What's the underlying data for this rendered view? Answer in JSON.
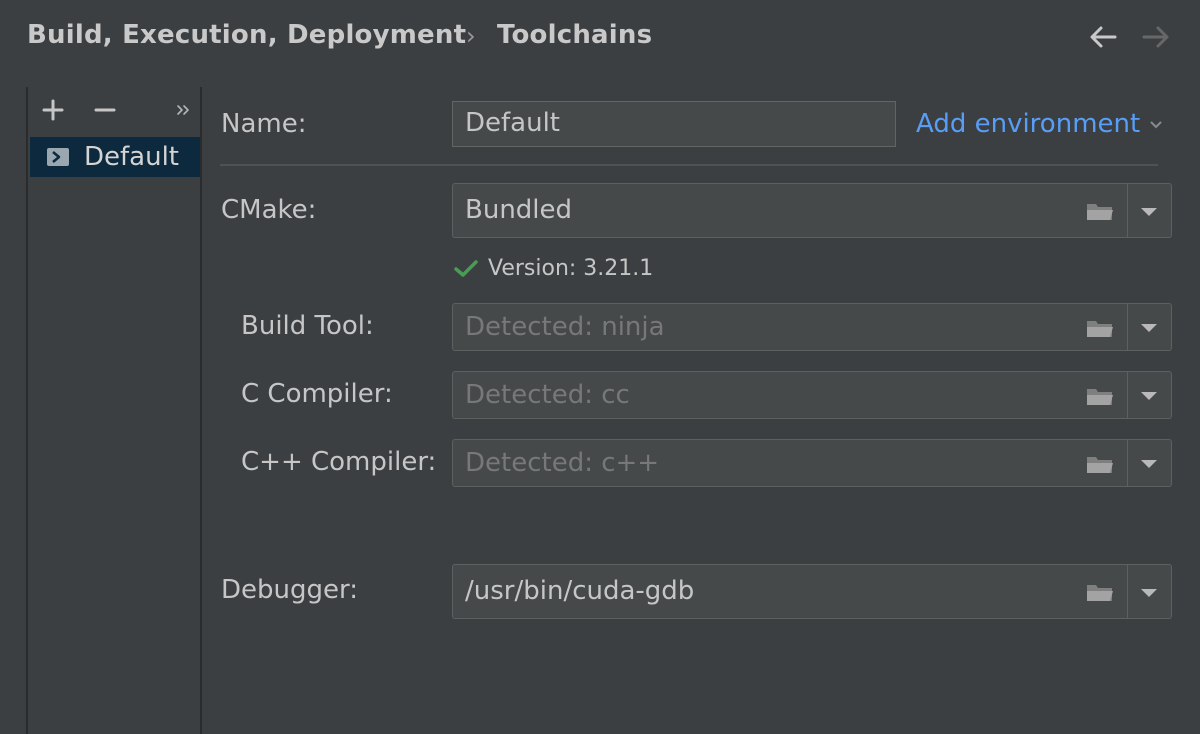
{
  "breadcrumb": {
    "parent": "Build, Execution, Deployment",
    "separator": "›",
    "current": "Toolchains"
  },
  "nav": {
    "back_icon": "arrow-left-icon",
    "forward_icon": "arrow-right-icon",
    "forward_enabled": false
  },
  "toolbar": {
    "add_icon": "plus-icon",
    "remove_icon": "minus-icon",
    "more_icon": "double-chevron-right-icon"
  },
  "toolchains": [
    {
      "name": "Default",
      "icon": "terminal-icon",
      "selected": true
    }
  ],
  "form": {
    "name_label": "Name:",
    "name_value": "Default",
    "add_environment": "Add environment",
    "cmake_label": "CMake:",
    "cmake_value": "Bundled",
    "cmake_version": "Version: 3.21.1",
    "build_tool_label": "Build Tool:",
    "build_tool_placeholder": "Detected: ninja",
    "c_compiler_label": "C Compiler:",
    "c_compiler_placeholder": "Detected: cc",
    "cpp_compiler_label": "C++ Compiler:",
    "cpp_compiler_placeholder": "Detected: c++",
    "debugger_label": "Debugger:",
    "debugger_value": "/usr/bin/cuda-gdb"
  },
  "colors": {
    "background": "#3c3f41",
    "field_background": "#45494a",
    "selection": "#0d293e",
    "link": "#589df6",
    "success": "#499c54"
  }
}
